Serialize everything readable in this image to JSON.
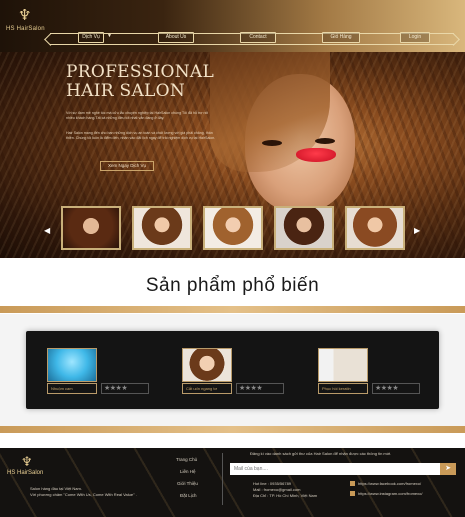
{
  "brand": {
    "logo_text": "HS HairSalon",
    "footer_logo_text": "HS HairSalon"
  },
  "nav": {
    "items": [
      "Dịch Vụ",
      "About Us",
      "Contact",
      "Giỏ Hàng",
      "Login"
    ]
  },
  "hero": {
    "title_line1": "PROFESSIONAL",
    "title_line2": "HAIR SALON",
    "para1": "Với sự đam mê nghề tóc mà cửu lắc chuyên nghiệp tại HairSalon chúng Tôi đã hỗ trợ rất nhiều khách hàng.Tất cả những điều tốt nhất vẫn đang ở đây.",
    "para2": "Hair Salon mang đến cho bạn những dịch vụ an toàn và chất lượng với giá phải chăng, thân thiện. Chúng tôi luôn là điểm đến, nhận vào đặt lịch ngay để trải nghiệm dịch vụ tại HairSalon.",
    "button": "Xem Ngay Dịch Vụ"
  },
  "section_title": "Sản phẩm phổ biến",
  "products": [
    {
      "name": "Nhuộm cam",
      "stars": "★★★★"
    },
    {
      "name": "Cắt uốn ngang tơ",
      "stars": "★★★★"
    },
    {
      "name": "Phục hồi keratin",
      "stars": "★★★★"
    }
  ],
  "footer": {
    "tagline1": "Salon hàng đầu tại Việt Nam.",
    "tagline2": "Với phương châm \"Come With Us, Come With Real Value\" .",
    "links": [
      "Trang Chủ",
      "Liên Hệ",
      "Giới Thiệu",
      "Đặt Lịch"
    ],
    "subscribe": "Đăng kí vào danh sách gửi thư của Hair Salon để nhận được các thông tin mới.",
    "email_placeholder": "Mail của bạn....",
    "hotline": "Hot line : 0935/56789",
    "mail": "Mail : fromexo@gmail.com",
    "address": "Địa Chỉ : TP. Hồ Chí Minh, Việt Nam",
    "facebook": "https://www.facebook.com/fromexo/",
    "instagram": "https://www.instagram.com/fromexo/"
  },
  "colors": {
    "gold": "#c99a58",
    "dark": "#141210",
    "accent_red": "#e0202f"
  }
}
